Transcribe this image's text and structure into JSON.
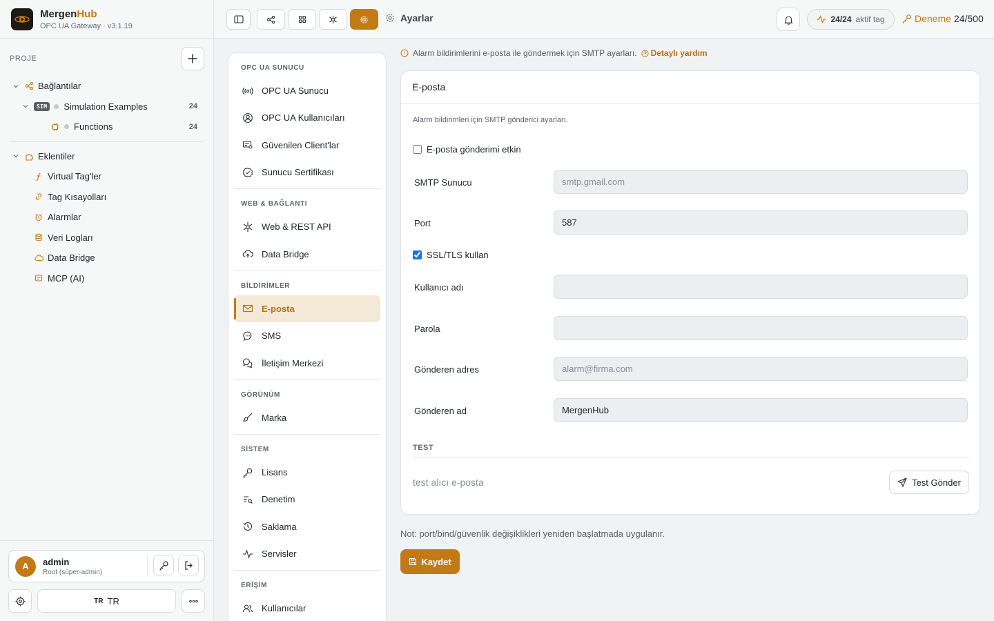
{
  "app": {
    "name_main": "Mergen",
    "name_accent": "Hub",
    "subtitle": "OPC UA Gateway · v3.1.19"
  },
  "sidebar": {
    "section_label": "PROJE",
    "tree": [
      {
        "label": "Bağlantılar",
        "icon": "connections-icon"
      },
      {
        "label": "Simulation Examples",
        "badge": "SIM",
        "count": "24",
        "icon": "sim-badge"
      },
      {
        "label": "Functions",
        "count": "24",
        "icon": "function-chip-icon"
      },
      {
        "label": "Eklentiler",
        "icon": "plugin-icon"
      },
      {
        "label": "Virtual Tag'ler",
        "icon": "function-icon"
      },
      {
        "label": "Tag Kısayolları",
        "icon": "link-icon"
      },
      {
        "label": "Alarmlar",
        "icon": "alarm-clock-icon"
      },
      {
        "label": "Veri Logları",
        "icon": "database-icon"
      },
      {
        "label": "Data Bridge",
        "icon": "cloud-icon"
      },
      {
        "label": "MCP (AI)",
        "icon": "mcp-icon"
      }
    ],
    "user": {
      "initial": "A",
      "name": "admin",
      "role": "Root (süper-admin)"
    },
    "language": {
      "code_small": "TR",
      "label": "TR"
    }
  },
  "topbar": {
    "breadcrumb": "Ayarlar",
    "tag_count": "24/24",
    "tag_label": "aktif tag",
    "trial_label": "Deneme",
    "trial_count": "24/500"
  },
  "settings_nav": {
    "groups": [
      {
        "title": "OPC UA SUNUCU",
        "items": [
          "OPC UA Sunucu",
          "OPC UA Kullanıcıları",
          "Güvenilen Client'lar",
          "Sunucu Sertifikası"
        ]
      },
      {
        "title": "WEB & BAĞLANTI",
        "items": [
          "Web & REST API",
          "Data Bridge"
        ]
      },
      {
        "title": "BİLDİRİMLER",
        "items": [
          "E-posta",
          "SMS",
          "İletişim Merkezi"
        ]
      },
      {
        "title": "GÖRÜNÜM",
        "items": [
          "Marka"
        ]
      },
      {
        "title": "SİSTEM",
        "items": [
          "Lisans",
          "Denetim",
          "Saklama",
          "Servisler"
        ]
      },
      {
        "title": "ERİŞİM",
        "items": [
          "Kullanıcılar"
        ]
      }
    ],
    "active": "E-posta"
  },
  "content": {
    "info": "Alarm bildirimlerini e-posta ile göndermek için SMTP ayarları.",
    "help_link": "Detaylı yardım",
    "card_title": "E-posta",
    "card_desc": "Alarm bildirimleri için SMTP gönderici ayarları.",
    "enable_label": "E-posta gönderimi etkin",
    "enable_checked": false,
    "smtp_label": "SMTP Sunucu",
    "smtp_placeholder": "smtp.gmail.com",
    "smtp_value": "",
    "port_label": "Port",
    "port_value": "587",
    "ssl_label": "SSL/TLS kullan",
    "ssl_checked": true,
    "username_label": "Kullanıcı adı",
    "username_value": "",
    "password_label": "Parola",
    "password_value": "",
    "from_addr_label": "Gönderen adres",
    "from_addr_placeholder": "alarm@firma.com",
    "from_addr_value": "",
    "from_name_label": "Gönderen ad",
    "from_name_value": "MergenHub",
    "test_title": "TEST",
    "test_placeholder": "test alıcı e-posta",
    "test_button": "Test Gönder",
    "note": "Not: port/bind/güvenlik değişiklikleri yeniden başlatmada uygulanır.",
    "save_button": "Kaydet"
  },
  "colors": {
    "accent": "#c27a17",
    "active_bg": "#f4e8d7"
  }
}
